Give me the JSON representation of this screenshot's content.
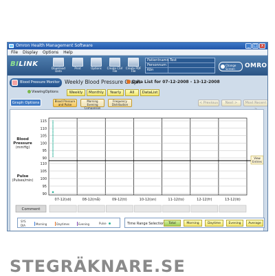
{
  "window": {
    "title": "Omron Health Management Software",
    "controls": {
      "minimize": "_",
      "maximize": "□",
      "close": "x"
    }
  },
  "menu": [
    "File",
    "Display",
    "Options",
    "Help"
  ],
  "toolbar": {
    "logo_prefix": "BI",
    "logo_suffix": "LINK",
    "buttons": [
      "Download Data",
      "Print",
      "Options",
      "Create CSV File",
      "Create PDF File"
    ]
  },
  "patient": {
    "rows": [
      {
        "label": "Patientnamn",
        "value": "Test"
      },
      {
        "label": "Personnum",
        "value": ""
      },
      {
        "label": "Kön",
        "value": ""
      }
    ]
  },
  "change_screen": {
    "label1": "Change",
    "label2": "Screen"
  },
  "brand_logo": "OMRON",
  "section": {
    "badge": "Blood Pressure Monitor",
    "graph_title": "Weekly Blood Pressure Graph",
    "data_list_label": "Data List for 07-12-2008 - 13-12-2008"
  },
  "viewing": {
    "label": "ViewingOptions",
    "buttons": [
      "Weekly",
      "Monthly",
      "Yearly",
      "All",
      "DataList"
    ]
  },
  "graph_options": {
    "label": "Graph Options",
    "buttons": [
      "Blood Pressure and Pulse",
      "Morning Evening Comparison",
      "Frequency Distribution"
    ],
    "nav": [
      "< Previous",
      "Next >",
      "Most Recent >"
    ]
  },
  "chart_data": {
    "type": "scatter",
    "categories": [
      "07-12(sö)",
      "08-12(må)",
      "09-12(ti)",
      "10-12(on)",
      "11-12(to)",
      "12-12(fr)",
      "13-12(lö)"
    ],
    "bp": {
      "ylabel": "Blood Pressure (mmHg)",
      "ylim": [
        90,
        115
      ],
      "ticks": [
        115,
        110,
        105,
        100,
        95,
        90
      ],
      "series": [
        {
          "values_x": 0,
          "y": [
            115,
            114,
            113,
            112,
            111,
            110,
            109,
            108,
            107,
            106,
            105,
            104,
            103,
            102,
            101,
            100,
            99,
            98,
            97,
            96,
            95,
            94,
            93,
            92,
            91
          ]
        }
      ]
    },
    "pulse": {
      "ylabel": "Pulse (Pulses/min)",
      "ylim": [
        90,
        110
      ],
      "ticks": [
        110,
        105,
        100,
        95,
        90
      ],
      "series": [
        {
          "values_x": 0,
          "y": [
            91
          ]
        }
      ]
    },
    "threshold_line": true,
    "comment_label": "Comment",
    "view_side_label": "View Entries"
  },
  "legend": {
    "dys": "SYS",
    "dia": "DIA",
    "items": [
      {
        "label": "Morning",
        "color": "#3b7ddd"
      },
      {
        "label": "Daytimes",
        "color": "#e36c1c"
      },
      {
        "label": "Evening",
        "color": "#7a3fb0"
      },
      {
        "label": "Pulse",
        "color": "#2db39a"
      }
    ]
  },
  "time_range": {
    "label": "Time Range Selection",
    "buttons": [
      "Total",
      "Morning",
      "Daytime",
      "Evening",
      "Average"
    ],
    "active": "Total"
  },
  "footer_brand": "STEGRÄKNARE.SE"
}
